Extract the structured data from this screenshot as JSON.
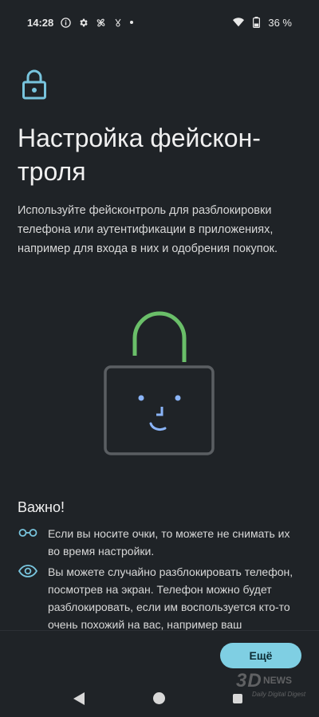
{
  "status_bar": {
    "time": "14:28",
    "battery": "36 %",
    "icons": [
      "info-icon",
      "gear-icon",
      "fan-icon",
      "vpn-icon",
      "dot",
      "wifi-icon",
      "battery-icon"
    ]
  },
  "page": {
    "title": "Настройка фейскон-\nтроля",
    "description": "Используйте фейсконтроль для разблокировки телефона или аутентификации в приложениях, например для входа в них и одобрения покупок."
  },
  "important": {
    "heading": "Важно!",
    "tips": [
      {
        "icon": "glasses-icon",
        "text": "Если вы носите очки, то можете не снимать их во время настройки."
      },
      {
        "icon": "eye-icon",
        "text": "Вы можете случайно разблокировать телефон, посмотрев на экран. Телефон можно будет разблокировать, если им воспользуется кто-то очень похожий на вас, например ваш"
      }
    ]
  },
  "buttons": {
    "more": "Ещё"
  },
  "watermark": {
    "main": "3D",
    "sub": "NEWS",
    "tag": "Daily Digital Digest"
  },
  "colors": {
    "background": "#1f2327",
    "accent": "#7fcfe3",
    "lock_icon": "#78c4dd",
    "shackle": "#6abf69",
    "face": "#8ab4f8",
    "frame": "#5a5e62"
  }
}
